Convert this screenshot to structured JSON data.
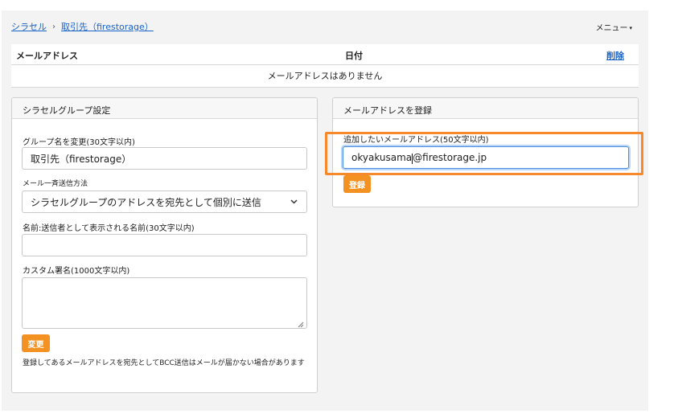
{
  "breadcrumb": {
    "root": "シラセル",
    "separator": "›",
    "current": "取引先（firestorage）"
  },
  "menu": {
    "label": "メニュー",
    "caret": "▾"
  },
  "table": {
    "headers": {
      "email": "メールアドレス",
      "date": "日付",
      "delete": "削除"
    },
    "empty_message": "メールアドレスはありません"
  },
  "group_settings": {
    "title": "シラセルグループ設定",
    "name_label": "グループ名を変更(30文字以内)",
    "name_value": "取引先（firestorage）",
    "send_method_label": "メール一斉送信方法",
    "send_method_value": "シラセルグループのアドレスを宛先として個別に送信",
    "sender_name_label": "名前:送信者として表示される名前(30文字以内)",
    "sender_name_value": "",
    "signature_label": "カスタム署名(1000文字以内)",
    "signature_value": "",
    "change_button": "変更",
    "note": "登録してあるメールアドレスを宛先としてBCC送信はメールが届かない場合があります"
  },
  "register_email": {
    "title": "メールアドレスを登録",
    "add_label": "追加したいメールアドレス(50文字以内)",
    "input_before_cursor": "okyakusama",
    "input_after_cursor": "@firestorage.jp",
    "register_button": "登録"
  },
  "colors": {
    "accent_button": "#f39222",
    "link": "#1a63c7",
    "annotation_highlight": "#f7892a",
    "focus_ring": "#4a8fe0"
  },
  "icons": {
    "select_chevron": "chevron-down-icon",
    "menu_caret": "caret-down-icon",
    "resize": "resize-handle-icon"
  }
}
